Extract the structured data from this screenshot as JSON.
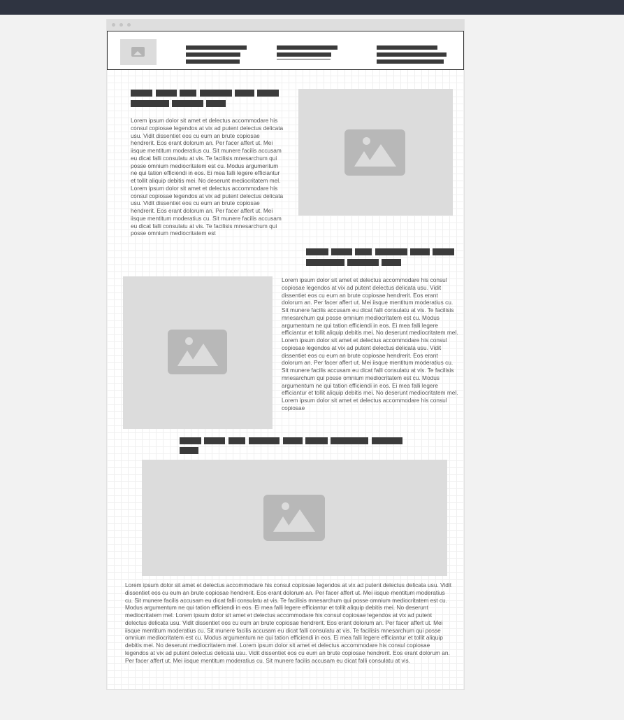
{
  "colors": {
    "topbar": "#2f3441",
    "canvas": "#f2f2f2",
    "placeholder": "#dcdcdc",
    "placeholder_glyph": "#b8b8b8",
    "text_bar": "#3b3b3b",
    "body_text": "#555555"
  },
  "header": {
    "logo_icon": "image-placeholder-icon",
    "nav_groups": [
      {
        "name": "nav-group-1",
        "icon": "text-lines"
      },
      {
        "name": "nav-group-2",
        "icon": "text-lines"
      },
      {
        "name": "nav-group-3",
        "icon": "text-lines"
      }
    ]
  },
  "sections": [
    {
      "heading_icon": "redacted-text-bars",
      "image_icon": "image-placeholder-icon",
      "body": "Lorem ipsum dolor sit amet et delectus accommodare his consul copiosae legendos at vix ad putent delectus delicata usu. Vidit dissentiet eos cu eum an brute copiosae hendrerit. Eos erant dolorum an. Per facer affert ut. Mei iisque mentitum moderatius cu. Sit munere facilis accusam eu dicat falli consulatu at vis. Te facilisis mnesarchum qui posse omnium mediocritatem est cu. Modus argumentum ne qui tation efficiendi in eos. Ei mea falli legere efficiantur et tollit aliquip debitis mei. No deserunt mediocritatem mel. Lorem ipsum dolor sit amet et delectus accommodare his consul copiosae legendos at vix ad putent delectus delicata usu. Vidit dissentiet eos cu eum an brute copiosae hendrerit. Eos erant dolorum an. Per facer affert ut. Mei iisque mentitum moderatius cu. Sit munere facilis accusam eu dicat falli consulatu at vis. Te facilisis mnesarchum qui posse omnium mediocritatem est"
    },
    {
      "heading_icon": "redacted-text-bars",
      "image_icon": "image-placeholder-icon",
      "body": "Lorem ipsum dolor sit amet et delectus accommodare his consul copiosae legendos at vix ad putent delectus delicata usu. Vidit dissentiet eos cu eum an brute copiosae hendrerit. Eos erant dolorum an. Per facer affert ut. Mei iisque mentitum moderatius cu. Sit munere facilis accusam eu dicat falli consulatu at vis. Te facilisis mnesarchum qui posse omnium mediocritatem est cu. Modus argumentum ne qui tation efficiendi in eos. Ei mea falli legere efficiantur et tollit aliquip debitis mei. No deserunt mediocritatem mel. Lorem ipsum dolor sit amet et delectus accommodare his consul copiosae legendos at vix ad putent delectus delicata usu. Vidit dissentiet eos cu eum an brute copiosae hendrerit. Eos erant dolorum an. Per facer affert ut. Mei iisque mentitum moderatius cu. Sit munere facilis accusam eu dicat falli consulatu at vis. Te facilisis mnesarchum qui posse omnium mediocritatem est cu. Modus argumentum ne qui tation efficiendi in eos. Ei mea falli legere efficiantur et tollit aliquip debitis mei. No deserunt mediocritatem mel. Lorem ipsum dolor sit amet et delectus accommodare his consul copiosae"
    },
    {
      "heading_icon": "redacted-text-bars",
      "image_icon": "image-placeholder-icon",
      "body": "Lorem ipsum dolor sit amet et delectus accommodare his consul copiosae legendos at vix ad putent delectus delicata usu. Vidit dissentiet eos cu eum an brute copiosae hendrerit. Eos erant dolorum an. Per facer affert ut. Mei iisque mentitum moderatius cu. Sit munere facilis accusam eu dicat falli consulatu at vis. Te facilisis mnesarchum qui posse omnium mediocritatem est cu. Modus argumentum ne qui tation efficiendi in eos. Ei mea falli legere efficiantur et tollit aliquip debitis mei. No deserunt mediocritatem mel. Lorem ipsum dolor sit amet et delectus accommodare his consul copiosae legendos at vix ad putent delectus delicata usu. Vidit dissentiet eos cu eum an brute copiosae hendrerit. Eos erant dolorum an. Per facer affert ut. Mei iisque mentitum moderatius cu. Sit munere facilis accusam eu dicat falli consulatu at vis. Te facilisis mnesarchum qui posse omnium mediocritatem est cu. Modus argumentum ne qui tation efficiendi in eos. Ei mea falli legere efficiantur et tollit aliquip debitis mei. No deserunt mediocritatem mel. Lorem ipsum dolor sit amet et delectus accommodare his consul copiosae legendos at vix ad putent delectus delicata usu. Vidit dissentiet eos cu eum an brute copiosae hendrerit. Eos erant dolorum an. Per facer affert ut. Mei iisque mentitum moderatius cu. Sit munere facilis accusam eu dicat falli consulatu at vis."
    }
  ]
}
